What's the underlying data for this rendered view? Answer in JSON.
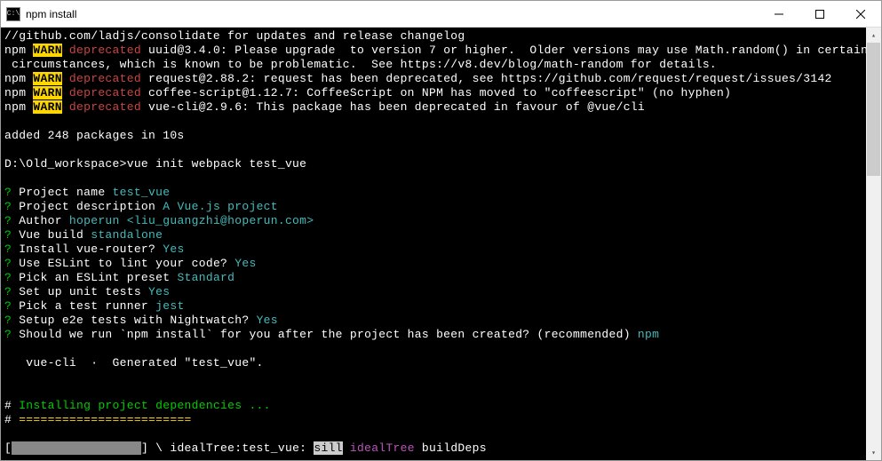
{
  "titlebar": {
    "icon_label": "C:\\",
    "title": "npm install"
  },
  "lines": [
    [
      {
        "t": "//github.com/ladjs/consolidate for updates and release changelog",
        "c": "white"
      }
    ],
    [
      {
        "t": "npm ",
        "c": "white"
      },
      {
        "t": "WARN",
        "c": "warn"
      },
      {
        "t": " ",
        "c": ""
      },
      {
        "t": "deprecated",
        "c": "deprecated"
      },
      {
        "t": " uuid@3.4.0: Please upgrade  to version 7 or higher.  Older versions may use Math.random() in certain",
        "c": "white"
      }
    ],
    [
      {
        "t": " circumstances, which is known to be problematic.  See https://v8.dev/blog/math-random for details.",
        "c": "white"
      }
    ],
    [
      {
        "t": "npm ",
        "c": "white"
      },
      {
        "t": "WARN",
        "c": "warn"
      },
      {
        "t": " ",
        "c": ""
      },
      {
        "t": "deprecated",
        "c": "deprecated"
      },
      {
        "t": " request@2.88.2: request has been deprecated, see https://github.com/request/request/issues/3142",
        "c": "white"
      }
    ],
    [
      {
        "t": "npm ",
        "c": "white"
      },
      {
        "t": "WARN",
        "c": "warn"
      },
      {
        "t": " ",
        "c": ""
      },
      {
        "t": "deprecated",
        "c": "deprecated"
      },
      {
        "t": " coffee-script@1.12.7: CoffeeScript on NPM has moved to \"coffeescript\" (no hyphen)",
        "c": "white"
      }
    ],
    [
      {
        "t": "npm ",
        "c": "white"
      },
      {
        "t": "WARN",
        "c": "warn"
      },
      {
        "t": " ",
        "c": ""
      },
      {
        "t": "deprecated",
        "c": "deprecated"
      },
      {
        "t": " vue-cli@2.9.6: This package has been deprecated in favour of @vue/cli",
        "c": "white"
      }
    ],
    [
      {
        "t": " ",
        "c": ""
      }
    ],
    [
      {
        "t": "added 248 packages in 10s",
        "c": "white"
      }
    ],
    [
      {
        "t": " ",
        "c": ""
      }
    ],
    [
      {
        "t": "D:\\Old_workspace>vue init webpack test_vue",
        "c": "white"
      }
    ],
    [
      {
        "t": " ",
        "c": ""
      }
    ],
    [
      {
        "t": "?",
        "c": "green"
      },
      {
        "t": " Project name ",
        "c": "white"
      },
      {
        "t": "test_vue",
        "c": "cyan"
      }
    ],
    [
      {
        "t": "?",
        "c": "green"
      },
      {
        "t": " Project description ",
        "c": "white"
      },
      {
        "t": "A Vue.js project",
        "c": "cyan"
      }
    ],
    [
      {
        "t": "?",
        "c": "green"
      },
      {
        "t": " Author ",
        "c": "white"
      },
      {
        "t": "hoperun <liu_guangzhi@hoperun.com>",
        "c": "cyan"
      }
    ],
    [
      {
        "t": "?",
        "c": "green"
      },
      {
        "t": " Vue build ",
        "c": "white"
      },
      {
        "t": "standalone",
        "c": "cyan"
      }
    ],
    [
      {
        "t": "?",
        "c": "green"
      },
      {
        "t": " Install vue-router? ",
        "c": "white"
      },
      {
        "t": "Yes",
        "c": "cyan"
      }
    ],
    [
      {
        "t": "?",
        "c": "green"
      },
      {
        "t": " Use ESLint to lint your code? ",
        "c": "white"
      },
      {
        "t": "Yes",
        "c": "cyan"
      }
    ],
    [
      {
        "t": "?",
        "c": "green"
      },
      {
        "t": " Pick an ESLint preset ",
        "c": "white"
      },
      {
        "t": "Standard",
        "c": "cyan"
      }
    ],
    [
      {
        "t": "?",
        "c": "green"
      },
      {
        "t": " Set up unit tests ",
        "c": "white"
      },
      {
        "t": "Yes",
        "c": "cyan"
      }
    ],
    [
      {
        "t": "?",
        "c": "green"
      },
      {
        "t": " Pick a test runner ",
        "c": "white"
      },
      {
        "t": "jest",
        "c": "cyan"
      }
    ],
    [
      {
        "t": "?",
        "c": "green"
      },
      {
        "t": " Setup e2e tests with Nightwatch? ",
        "c": "white"
      },
      {
        "t": "Yes",
        "c": "cyan"
      }
    ],
    [
      {
        "t": "?",
        "c": "green"
      },
      {
        "t": " Should we run `npm install` for you after the project has been created? (recommended) ",
        "c": "white"
      },
      {
        "t": "npm",
        "c": "cyan"
      }
    ],
    [
      {
        "t": " ",
        "c": ""
      }
    ],
    [
      {
        "t": "   vue-cli  ·  Generated \"test_vue\".",
        "c": "white"
      }
    ],
    [
      {
        "t": " ",
        "c": ""
      }
    ],
    [
      {
        "t": " ",
        "c": ""
      }
    ],
    [
      {
        "t": "#",
        "c": "white"
      },
      {
        "t": " Installing project dependencies ...",
        "c": "green"
      }
    ],
    [
      {
        "t": "#",
        "c": "white"
      },
      {
        "t": " ========================",
        "c": "yellow"
      }
    ],
    [
      {
        "t": " ",
        "c": ""
      }
    ],
    [
      {
        "t": "[",
        "c": "white"
      },
      {
        "t": "                  ",
        "c": "pbar"
      },
      {
        "t": "] \\ idealTree:test_vue: ",
        "c": "white"
      },
      {
        "t": "sill",
        "c": "inv"
      },
      {
        "t": " ",
        "c": ""
      },
      {
        "t": "idealTree",
        "c": "magenta"
      },
      {
        "t": " buildDeps",
        "c": "white"
      }
    ]
  ]
}
